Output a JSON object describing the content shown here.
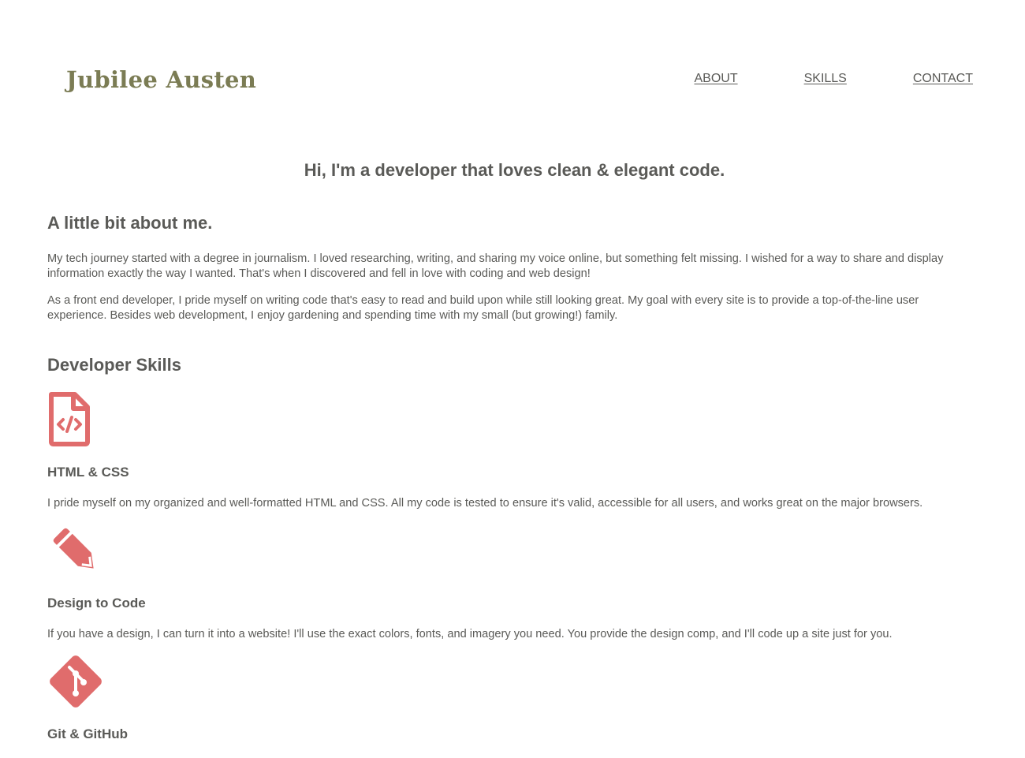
{
  "header": {
    "brand": "Jubilee Austen",
    "nav": [
      {
        "label": "ABOUT"
      },
      {
        "label": "SKILLS"
      },
      {
        "label": "CONTACT"
      }
    ]
  },
  "hero": {
    "title": "Hi, I'm a developer that loves clean & elegant code."
  },
  "about": {
    "heading": "A little bit about me.",
    "paragraphs": [
      "My tech journey started with a degree in journalism. I loved researching, writing, and sharing my voice online, but something felt missing. I wished for a way to share and display information exactly the way I wanted. That's when I discovered and fell in love with coding and web design!",
      "As a front end developer, I pride myself on writing code that's easy to read and build upon while still looking great. My goal with every site is to provide a top-of-the-line user experience. Besides web development, I enjoy gardening and spending time with my small (but growing!) family."
    ]
  },
  "skills": {
    "heading": "Developer Skills",
    "items": [
      {
        "icon": "file-code-icon",
        "title": "HTML & CSS",
        "description": "I pride myself on my organized and well-formatted HTML and CSS. All my code is tested to ensure it's valid, accessible for all users, and works great on the major browsers."
      },
      {
        "icon": "pencil-icon",
        "title": "Design to Code",
        "description": "If you have a design, I can turn it into a website! I'll use the exact colors, fonts, and imagery you need. You provide the design comp, and I'll code up a site just for you."
      },
      {
        "icon": "git-icon",
        "title": "Git & GitHub",
        "description": ""
      }
    ]
  },
  "colors": {
    "brand": "#7b7c54",
    "text": "#5a5a57",
    "icon": "#e06c6c",
    "background": "#ffffff"
  }
}
